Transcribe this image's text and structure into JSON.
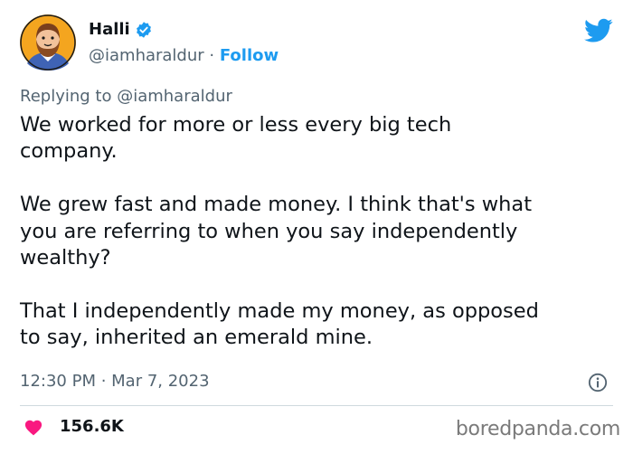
{
  "tweet": {
    "author_name": "Halli",
    "handle": "@iamharaldur",
    "separator": " · ",
    "follow_label": "Follow",
    "replying_prefix": "Replying to ",
    "replying_handle": "@iamharaldur",
    "paragraphs": [
      [
        "We worked for more or less every big tech",
        "company."
      ],
      [
        "We grew fast and made money. I think that's what",
        "you are referring to when you say independently",
        "wealthy?"
      ],
      [
        "That I independently made my money, as opposed",
        "to say, inherited an emerald mine."
      ]
    ],
    "timestamp": "12:30 PM · Mar 7, 2023",
    "like_count": "156.6K"
  },
  "watermark": "boredpanda.com",
  "colors": {
    "accent": "#1d9bf0",
    "secondary_text": "#536471",
    "heart": "#f91880",
    "divider": "#cfd9de"
  },
  "icons": [
    "avatar-illustration",
    "verified-badge-icon",
    "twitter-bird-icon",
    "info-icon",
    "heart-icon"
  ]
}
